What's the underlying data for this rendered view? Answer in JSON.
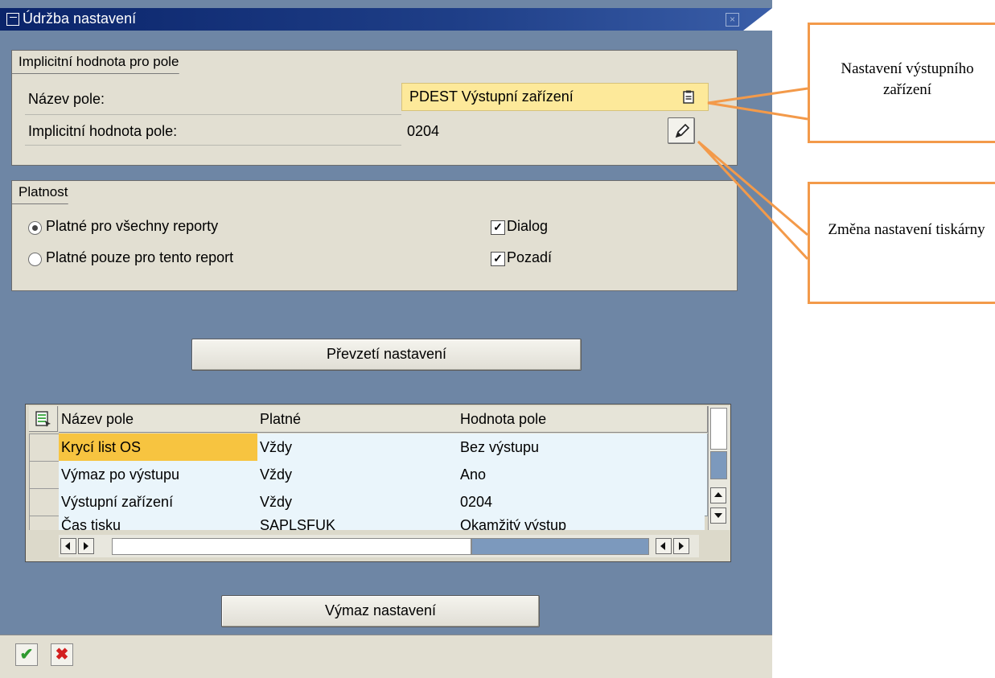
{
  "window": {
    "title": "Údržba nastavení"
  },
  "default_group": {
    "title": "Implicitní hodnota pro pole",
    "field_name_label": "Název pole:",
    "field_name_value": "PDEST Výstupní zařízení",
    "default_value_label": "Implicitní hodnota pole:",
    "default_value": "0204"
  },
  "validity_group": {
    "title": "Platnost",
    "radio_all": "Platné pro všechny reporty",
    "radio_this": "Platné pouze pro tento report",
    "check_dialog": "Dialog",
    "check_background": "Pozadí",
    "radio_all_selected": true,
    "dialog_checked": true,
    "background_checked": true
  },
  "buttons": {
    "apply": "Převzetí nastavení",
    "delete": "Výmaz nastavení"
  },
  "table": {
    "columns": [
      "Název pole",
      "Platné",
      "Hodnota pole"
    ],
    "rows": [
      [
        "Krycí list OS",
        "Vždy",
        "Bez výstupu"
      ],
      [
        "Výmaz po výstupu",
        "Vždy",
        "Ano"
      ],
      [
        "Výstupní zařízení",
        "Vždy",
        "0204"
      ],
      [
        "Čas tisku",
        "SAPLSFUK",
        "Okamžitý výstup"
      ]
    ]
  },
  "callouts": {
    "device": "Nastavení výstupního zařízení",
    "printer": "Změna nastavení tiskárny"
  },
  "toolbar": {
    "confirm_icon": "checkmark-icon",
    "cancel_icon": "cancel-x-icon"
  },
  "colors": {
    "accent_callout": "#f39a4a",
    "selected_cell": "#f7c440",
    "title_bar": "#0a246a"
  }
}
